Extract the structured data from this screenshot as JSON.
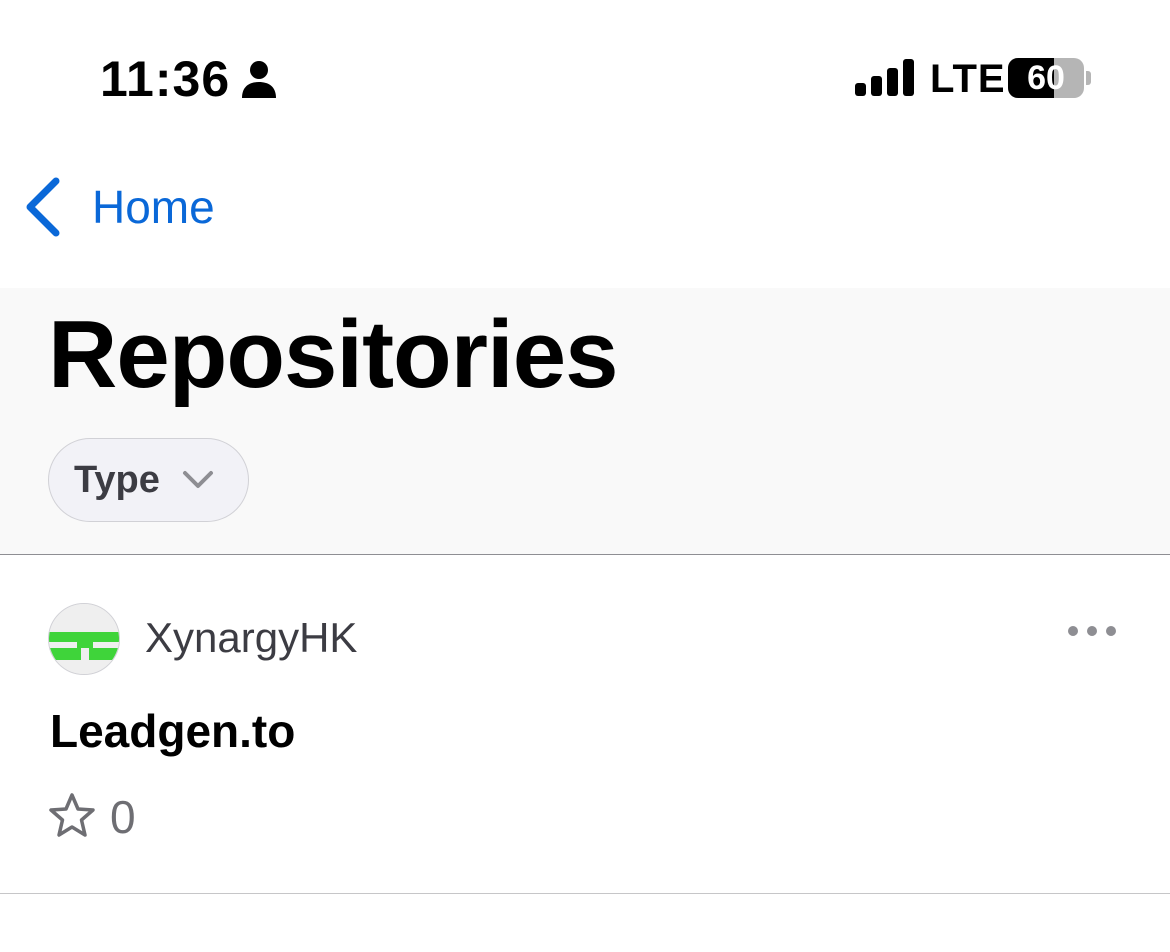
{
  "status_bar": {
    "time": "11:36",
    "network": "LTE",
    "battery_percent": 60,
    "battery_label": "60"
  },
  "nav": {
    "back_label": "Home",
    "accent_color": "#0a68d8"
  },
  "header": {
    "title": "Repositories",
    "filter_label": "Type"
  },
  "repositories": [
    {
      "owner": "XynargyHK",
      "name": "Leadgen.to",
      "stars": "0"
    }
  ],
  "icons": {
    "status": [
      "person-icon",
      "signal-icon",
      "battery-icon"
    ],
    "nav": "chevron-left-icon",
    "filter": "chevron-down-icon",
    "repo": [
      "avatar",
      "more-icon",
      "star-icon"
    ]
  }
}
